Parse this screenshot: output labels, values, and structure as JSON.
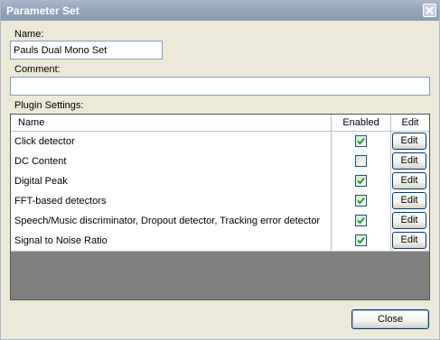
{
  "window": {
    "title": "Parameter Set",
    "close_glyph": "×"
  },
  "form": {
    "name_label": "Name:",
    "name_value": "Pauls Dual Mono Set",
    "comment_label": "Comment:",
    "comment_value": "",
    "plugin_settings_label": "Plugin Settings:"
  },
  "grid": {
    "columns": [
      "Name",
      "Enabled",
      "Edit"
    ],
    "rows": [
      {
        "name": "Click detector",
        "enabled": true,
        "edit_label": "Edit"
      },
      {
        "name": "DC Content",
        "enabled": false,
        "edit_label": "Edit"
      },
      {
        "name": "Digital Peak",
        "enabled": true,
        "edit_label": "Edit"
      },
      {
        "name": "FFT-based detectors",
        "enabled": true,
        "edit_label": "Edit"
      },
      {
        "name": "Speech/Music discriminator, Dropout detector, Tracking error detector",
        "enabled": true,
        "edit_label": "Edit"
      },
      {
        "name": "Signal to Noise Ratio",
        "enabled": true,
        "edit_label": "Edit"
      }
    ]
  },
  "footer": {
    "close_label": "Close"
  },
  "colors": {
    "titlebar": "#92a3bb",
    "checkmark": "#21a121",
    "empty_grid_area": "#808080"
  },
  "icons": {
    "window_close": "close-icon",
    "checked": "checkmark-icon"
  }
}
